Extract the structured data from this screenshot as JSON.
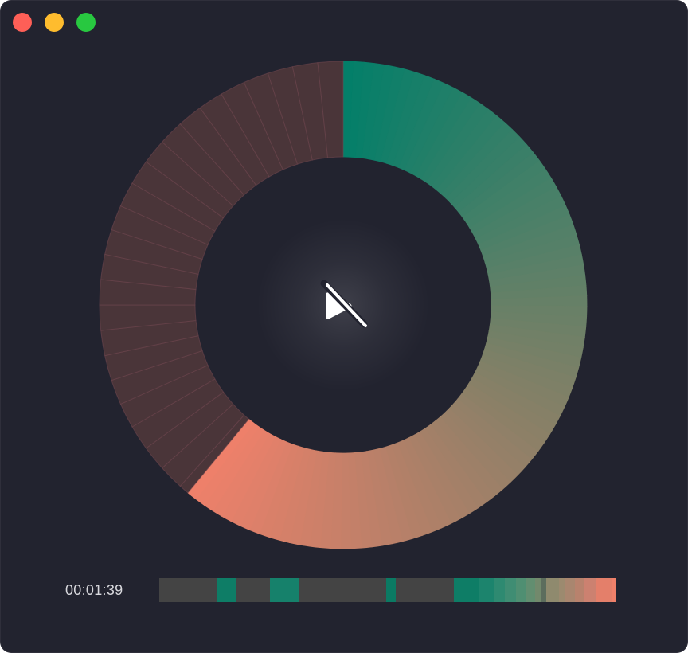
{
  "window": {
    "controls": [
      {
        "name": "close-button",
        "color": "#fe5f57"
      },
      {
        "name": "minimize-button",
        "color": "#febc2e"
      },
      {
        "name": "maximize-button",
        "color": "#28c840"
      }
    ]
  },
  "player": {
    "elapsed_time": "00:01:39",
    "progress_fraction": 0.61,
    "play_icon": "play-muted-icon",
    "colors": {
      "start": "#027f69",
      "mid": "#7d8067",
      "end": "#ef806a",
      "unplayed": "#4a3539",
      "background": "#22232f"
    }
  },
  "timeline": {
    "unplayed_color": "#444444",
    "segments": [
      {
        "width": 73,
        "color": "#444444"
      },
      {
        "width": 24,
        "color": "#0e7d66"
      },
      {
        "width": 42,
        "color": "#444444"
      },
      {
        "width": 37,
        "color": "#16816b"
      },
      {
        "width": 109,
        "color": "#444444"
      },
      {
        "width": 12,
        "color": "#0b7a63"
      },
      {
        "width": 73,
        "color": "#444444"
      },
      {
        "width": 32,
        "color": "#0e7d66"
      },
      {
        "width": 18,
        "color": "#1c846d"
      },
      {
        "width": 14,
        "color": "#2e8a71"
      },
      {
        "width": 14,
        "color": "#3f8d73"
      },
      {
        "width": 12,
        "color": "#4f8f72"
      },
      {
        "width": 12,
        "color": "#628e70"
      },
      {
        "width": 8,
        "color": "#72896c"
      },
      {
        "width": 6,
        "color": "#5c6d5d"
      },
      {
        "width": 16,
        "color": "#8f8a6e"
      },
      {
        "width": 8,
        "color": "#9c8a6f"
      },
      {
        "width": 12,
        "color": "#a9866f"
      },
      {
        "width": 12,
        "color": "#b8826d"
      },
      {
        "width": 14,
        "color": "#cc8170"
      },
      {
        "width": 20,
        "color": "#e47f6a"
      },
      {
        "width": 6,
        "color": "#ef806a"
      }
    ]
  }
}
